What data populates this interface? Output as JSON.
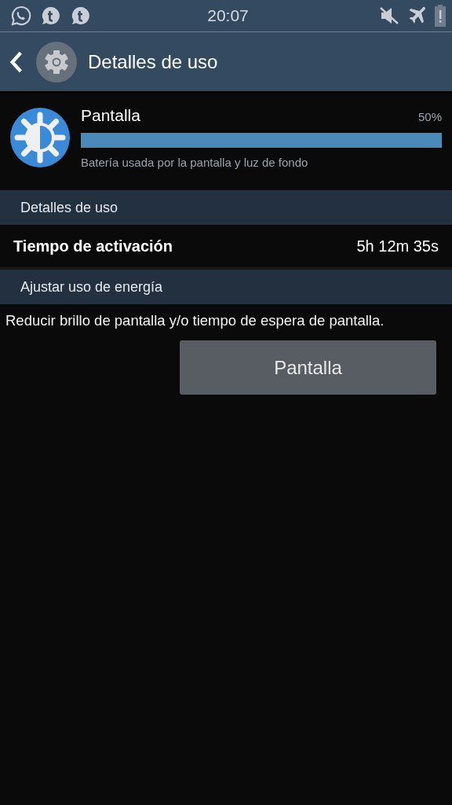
{
  "status_bar": {
    "time": "20:07"
  },
  "action_bar": {
    "title": "Detalles de uso"
  },
  "usage_item": {
    "name": "Pantalla",
    "percent": "50%",
    "level": 1,
    "description": "Batería usada por la pantalla y luz de fondo"
  },
  "sections": [
    {
      "header": "Detalles de uso",
      "rows": [
        {
          "label": "Tiempo de activación",
          "value": "5h 12m 35s"
        }
      ]
    },
    {
      "header": "Ajustar uso de energía",
      "text": "Reducir brillo de pantalla y/o tiempo de espera de pantalla.",
      "button": "Pantalla"
    }
  ]
}
